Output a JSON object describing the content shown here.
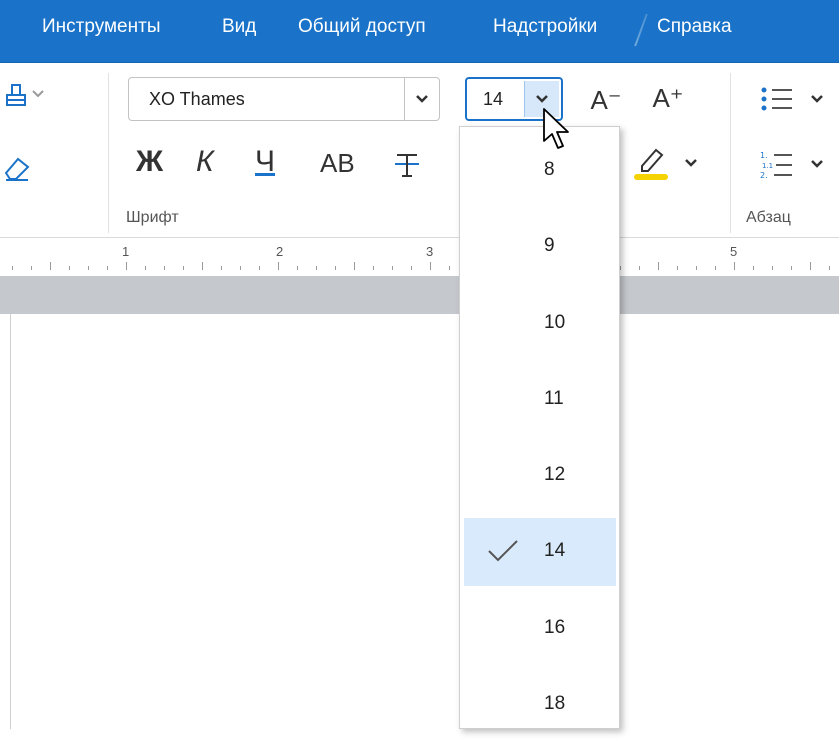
{
  "menubar": {
    "items": [
      "Инструменты",
      "Вид",
      "Общий доступ",
      "Надстройки",
      "Справка"
    ]
  },
  "ribbon": {
    "font_name": "XO Thames",
    "font_size": "14",
    "size_decrease_label": "A⁻",
    "size_increase_label": "A⁺",
    "bold_label": "Ж",
    "italic_label": "К",
    "underline_label": "Ч",
    "caps_label": "АВ",
    "font_group_label": "Шрифт",
    "paragraph_group_label": "Абзац"
  },
  "ruler": {
    "numbers": [
      "1",
      "2",
      "3",
      "5"
    ]
  },
  "font_size_dropdown": {
    "options": [
      "8",
      "9",
      "10",
      "11",
      "12",
      "14",
      "16",
      "18"
    ],
    "selected": "14"
  },
  "colors": {
    "accent": "#1a73c8",
    "selected_bg": "#d8eafb",
    "highlight_marker": "#f5d300"
  },
  "icons": [
    "format-painter-icon",
    "eraser-icon",
    "strikethrough-icon",
    "highlighter-icon",
    "bullet-list-icon",
    "numbered-list-icon",
    "chevron-down-icon",
    "checkmark-icon",
    "mouse-cursor-icon"
  ]
}
